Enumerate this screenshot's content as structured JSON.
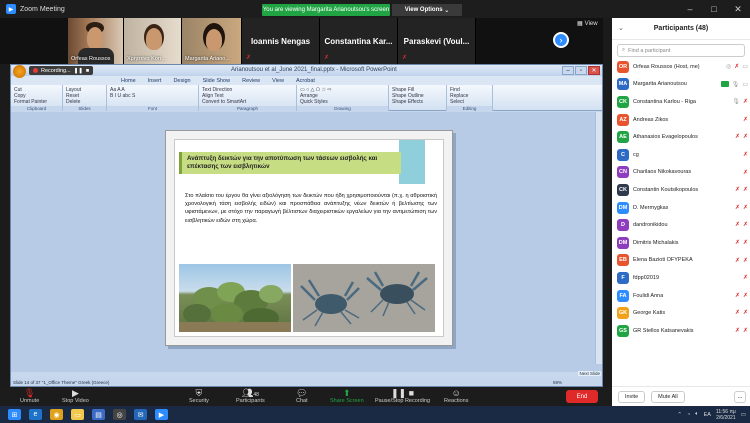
{
  "window": {
    "title": "Zoom Meeting",
    "banner": "You are viewing Margarita Arianoutsou's screen",
    "view_options": "View Options",
    "minimize": "–",
    "maximize": "□",
    "close": "✕"
  },
  "videos": [
    {
      "name": "Orfeas Roussos"
    },
    {
      "name": "Χρηστίνα Κοπ..."
    },
    {
      "name": "Margarita Ariano..."
    },
    {
      "name": "Ioannis Nengas"
    },
    {
      "name": "Constantina Kar..."
    },
    {
      "name": "Paraskevi (Voul..."
    }
  ],
  "view_button": "View",
  "powerpoint": {
    "title": "Arianoutsou et al_June 2021_final.pptx - Microsoft PowerPoint",
    "recording": "Recording...",
    "tabs": [
      "Home",
      "Insert",
      "Design",
      "Slide Show",
      "Review",
      "View",
      "Acrobat"
    ],
    "groups": [
      {
        "label": "Clipboard",
        "items": [
          "Cut",
          "Copy",
          "Format Painter",
          "Paste"
        ]
      },
      {
        "label": "Slides",
        "items": [
          "New Slide",
          "Layout",
          "Reset",
          "Delete"
        ]
      },
      {
        "label": "Font",
        "items": [
          "B I U abc S",
          "Aa A A"
        ]
      },
      {
        "label": "Paragraph",
        "items": [
          "Text Direction",
          "Align Text",
          "Convert to SmartArt"
        ]
      },
      {
        "label": "Drawing",
        "items": [
          "Arrange",
          "Quick Styles"
        ]
      },
      {
        "label": "Drawing",
        "items": [
          "Shape Fill",
          "Shape Outline",
          "Shape Effects"
        ]
      },
      {
        "label": "Editing",
        "items": [
          "Find",
          "Replace",
          "Select"
        ]
      }
    ],
    "status": "Slide 14 of 37   \"1_Office Theme\"   Greek (Greece)",
    "zoom": "59%",
    "next_slide": "Next Slide"
  },
  "slide": {
    "title": "Ανάπτυξη δεικτών για την αποτύπωση των τάσεων εισβολής και επέκτασης των εισβλητικών",
    "body": "Στο πλαίσιο του έργου θα γίνει αξιολόγηση των δεικτών που ήδη χρησιμοποιούνται (π.χ. η αθροιστική χρονολογική τάση εισβολής ειδών) και προσπάθεια ανάπτυξης νέων δεικτών ή βελτίωσης των υφιστάμενων, με στόχο την παραγωγή βέλτιστων διαχειριστικών εργαλείων για την αντιμετώπιση των εισβλητικών ειδών στη χώρα."
  },
  "participants": {
    "header": "Participants (48)",
    "search_placeholder": "Find a participant",
    "list": [
      {
        "initials": "OR",
        "name": "Orfeas Roussos (Host, me)",
        "color": "#e8542e",
        "icons": "host"
      },
      {
        "initials": "MA",
        "name": "Margarita Arianoutsou",
        "color": "#2d6bc4",
        "icons": "video"
      },
      {
        "initials": "CK",
        "name": "Constantina Karlou - Riga",
        "color": "#21a544",
        "icons": "mic"
      },
      {
        "initials": "AZ",
        "name": "Andreas Zikos",
        "color": "#e8542e",
        "icons": "muted"
      },
      {
        "initials": "AE",
        "name": "Athanasios Evagelopoulos",
        "color": "#21a544",
        "icons": "muted2"
      },
      {
        "initials": "C",
        "name": "cg",
        "color": "#2d6bc4",
        "icons": "muted"
      },
      {
        "initials": "CN",
        "name": "Charilaos Nikokavouras",
        "color": "#8e3dbf",
        "icons": "muted"
      },
      {
        "initials": "CK",
        "name": "Constantin Koutsikopoulos",
        "color": "#2f3b4c",
        "icons": "muted2"
      },
      {
        "initials": "DM",
        "name": "D. Mermygkas",
        "color": "#2d8cff",
        "icons": "muted2"
      },
      {
        "initials": "D",
        "name": "dandronikidou",
        "color": "#8e3dbf",
        "icons": "muted2"
      },
      {
        "initials": "DM",
        "name": "Dimitris Michalakis",
        "color": "#8e3dbf",
        "icons": "muted2"
      },
      {
        "initials": "EB",
        "name": "Elena Bazioti OFYPEKA",
        "color": "#e8542e",
        "icons": "muted2"
      },
      {
        "initials": "F",
        "name": "fdpp02019",
        "color": "#2d6bc4",
        "icons": "muted"
      },
      {
        "initials": "FA",
        "name": "Foulidi Anna",
        "color": "#2d8cff",
        "icons": "muted2"
      },
      {
        "initials": "GK",
        "name": "George Katis",
        "color": "#f2a21a",
        "icons": "muted2"
      },
      {
        "initials": "GS",
        "name": "GR Stellos Katsanevakis",
        "color": "#21a544",
        "icons": "muted2"
      }
    ],
    "invite": "Invite",
    "mute_all": "Mute All",
    "more": "..."
  },
  "toolbar": {
    "unmute": "Unmute",
    "stop_video": "Stop Video",
    "security": "Security",
    "participants": "Participants",
    "participants_count": "48",
    "chat": "Chat",
    "share_screen": "Share Screen",
    "recording": "Pause/Stop Recording",
    "reactions": "Reactions",
    "end": "End"
  },
  "taskbar": {
    "lang": "EA",
    "time": "11:56 πμ",
    "date": "2/6/2021"
  }
}
